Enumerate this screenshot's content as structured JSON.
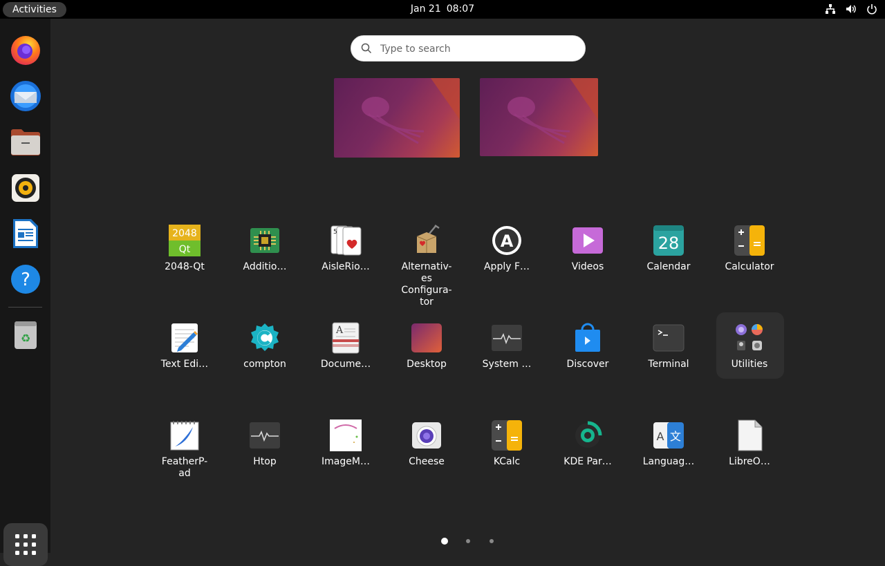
{
  "topbar": {
    "activities_label": "Activities",
    "date": "Jan 21",
    "time": "08:07",
    "tray": [
      "network-icon",
      "volume-icon",
      "power-icon"
    ]
  },
  "dock": {
    "items": [
      {
        "name": "Firefox",
        "icon": "firefox-icon"
      },
      {
        "name": "Thunderbird",
        "icon": "thunderbird-icon"
      },
      {
        "name": "Files",
        "icon": "files-icon"
      },
      {
        "name": "Rhythmbox",
        "icon": "rhythmbox-icon"
      },
      {
        "name": "LibreOffice Writer",
        "icon": "writer-icon"
      },
      {
        "name": "Help",
        "icon": "help-icon"
      },
      {
        "name": "Trash",
        "icon": "trash-icon"
      }
    ],
    "apps_button_icon": "grid-icon"
  },
  "search": {
    "placeholder": "Type to search"
  },
  "apps": [
    {
      "label": "2048-Qt",
      "icon": "game-2048-icon"
    },
    {
      "label": "Additio…",
      "icon": "chip-icon"
    },
    {
      "label": "AisleRio…",
      "icon": "cards-icon"
    },
    {
      "label": "Alternativ-\nes\nConfigura-\ntor",
      "icon": "alternatives-icon"
    },
    {
      "label": "Apply F…",
      "icon": "apply-icon"
    },
    {
      "label": "Videos",
      "icon": "videos-icon"
    },
    {
      "label": "Calendar",
      "icon": "calendar-icon",
      "day": "28"
    },
    {
      "label": "Calculator",
      "icon": "calculator-icon"
    },
    {
      "label": "Text Edi…",
      "icon": "text-editor-icon"
    },
    {
      "label": "compton",
      "icon": "compton-icon"
    },
    {
      "label": "Docume…",
      "icon": "document-viewer-icon"
    },
    {
      "label": "Desktop",
      "icon": "desktop-icon"
    },
    {
      "label": "System …",
      "icon": "system-monitor-icon"
    },
    {
      "label": "Discover",
      "icon": "discover-icon"
    },
    {
      "label": "Terminal",
      "icon": "terminal-icon"
    },
    {
      "label": "Utilities",
      "icon": "utilities-folder-icon"
    },
    {
      "label": "FeatherP-\nad",
      "icon": "featherpad-icon"
    },
    {
      "label": "Htop",
      "icon": "htop-icon"
    },
    {
      "label": "ImageM…",
      "icon": "imagemagick-icon"
    },
    {
      "label": "Cheese",
      "icon": "cheese-icon"
    },
    {
      "label": "KCalc",
      "icon": "kcalc-icon"
    },
    {
      "label": "KDE Par…",
      "icon": "kde-partition-icon"
    },
    {
      "label": "Languag…",
      "icon": "language-icon"
    },
    {
      "label": "LibreO…",
      "icon": "libreoffice-icon"
    }
  ],
  "pages": {
    "count": 3,
    "current": 1
  },
  "colors": {
    "topbar": "#000000",
    "dock": "#171717",
    "background": "#242424",
    "accent": "#e95420"
  }
}
